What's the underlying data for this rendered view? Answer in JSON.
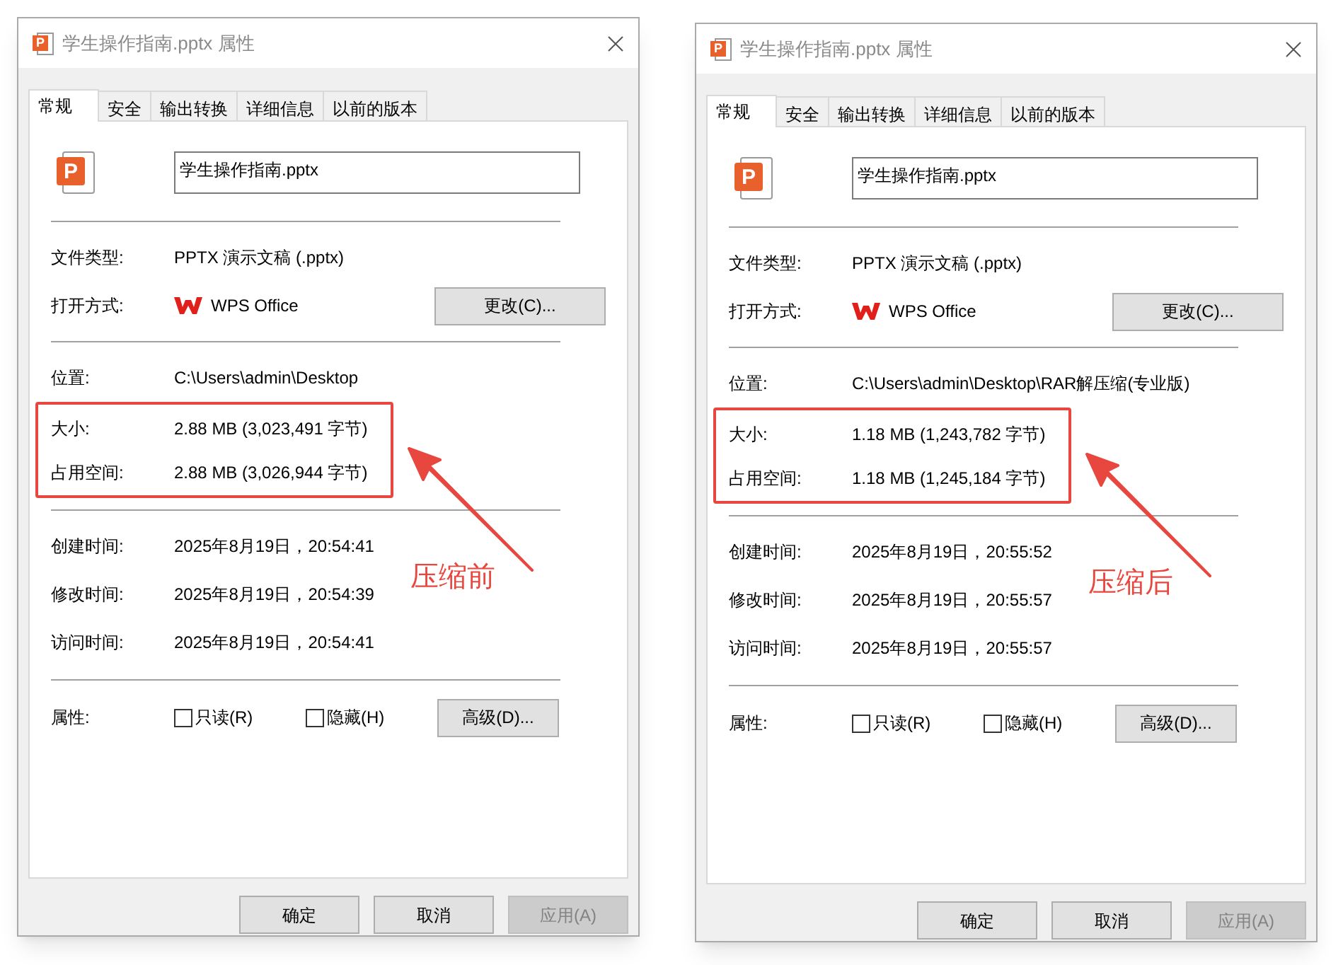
{
  "dialogs": [
    {
      "title": "学生操作指南.pptx 属性",
      "title_icon_letter": "P",
      "tabs": [
        {
          "label": "常规",
          "selected": true
        },
        {
          "label": "安全",
          "selected": false
        },
        {
          "label": "输出转换",
          "selected": false
        },
        {
          "label": "详细信息",
          "selected": false
        },
        {
          "label": "以前的版本",
          "selected": false
        }
      ],
      "file_icon_letter": "P",
      "file_name": "学生操作指南.pptx",
      "file_type": {
        "label": "文件类型:",
        "value": "PPTX 演示文稿 (.pptx)"
      },
      "open_with": {
        "label": "打开方式:",
        "app": "WPS Office",
        "button": "更改(C)..."
      },
      "location": {
        "label": "位置:",
        "value": "C:\\Users\\admin\\Desktop"
      },
      "size": {
        "label": "大小:",
        "value": "2.88 MB (3,023,491 字节)"
      },
      "size_on_disk": {
        "label": "占用空间:",
        "value": "2.88 MB (3,026,944 字节)"
      },
      "times": [
        {
          "label": "创建时间:",
          "value": "2025年8月19日，20:54:41"
        },
        {
          "label": "修改时间:",
          "value": "2025年8月19日，20:54:39"
        },
        {
          "label": "访问时间:",
          "value": "2025年8月19日，20:54:41"
        }
      ],
      "attributes": {
        "label": "属性:",
        "checkboxes": [
          {
            "label": "只读(R)",
            "checked": false
          },
          {
            "label": "隐藏(H)",
            "checked": false
          }
        ],
        "button": "高级(D)..."
      },
      "annotation": {
        "label": "压缩前"
      },
      "buttons": [
        {
          "label": "确定",
          "disabled": false
        },
        {
          "label": "取消",
          "disabled": false
        },
        {
          "label": "应用(A)",
          "disabled": true
        }
      ]
    },
    {
      "title": "学生操作指南.pptx 属性",
      "title_icon_letter": "P",
      "tabs": [
        {
          "label": "常规",
          "selected": true
        },
        {
          "label": "安全",
          "selected": false
        },
        {
          "label": "输出转换",
          "selected": false
        },
        {
          "label": "详细信息",
          "selected": false
        },
        {
          "label": "以前的版本",
          "selected": false
        }
      ],
      "file_icon_letter": "P",
      "file_name": "学生操作指南.pptx",
      "file_type": {
        "label": "文件类型:",
        "value": "PPTX 演示文稿 (.pptx)"
      },
      "open_with": {
        "label": "打开方式:",
        "app": "WPS Office",
        "button": "更改(C)..."
      },
      "location": {
        "label": "位置:",
        "value": "C:\\Users\\admin\\Desktop\\RAR解压缩(专业版)"
      },
      "size": {
        "label": "大小:",
        "value": "1.18 MB (1,243,782 字节)"
      },
      "size_on_disk": {
        "label": "占用空间:",
        "value": "1.18 MB (1,245,184 字节)"
      },
      "times": [
        {
          "label": "创建时间:",
          "value": "2025年8月19日，20:55:52"
        },
        {
          "label": "修改时间:",
          "value": "2025年8月19日，20:55:57"
        },
        {
          "label": "访问时间:",
          "value": "2025年8月19日，20:55:57"
        }
      ],
      "attributes": {
        "label": "属性:",
        "checkboxes": [
          {
            "label": "只读(R)",
            "checked": false
          },
          {
            "label": "隐藏(H)",
            "checked": false
          }
        ],
        "button": "高级(D)..."
      },
      "annotation": {
        "label": "压缩后"
      },
      "buttons": [
        {
          "label": "确定",
          "disabled": false
        },
        {
          "label": "取消",
          "disabled": false
        },
        {
          "label": "应用(A)",
          "disabled": true
        }
      ]
    }
  ]
}
